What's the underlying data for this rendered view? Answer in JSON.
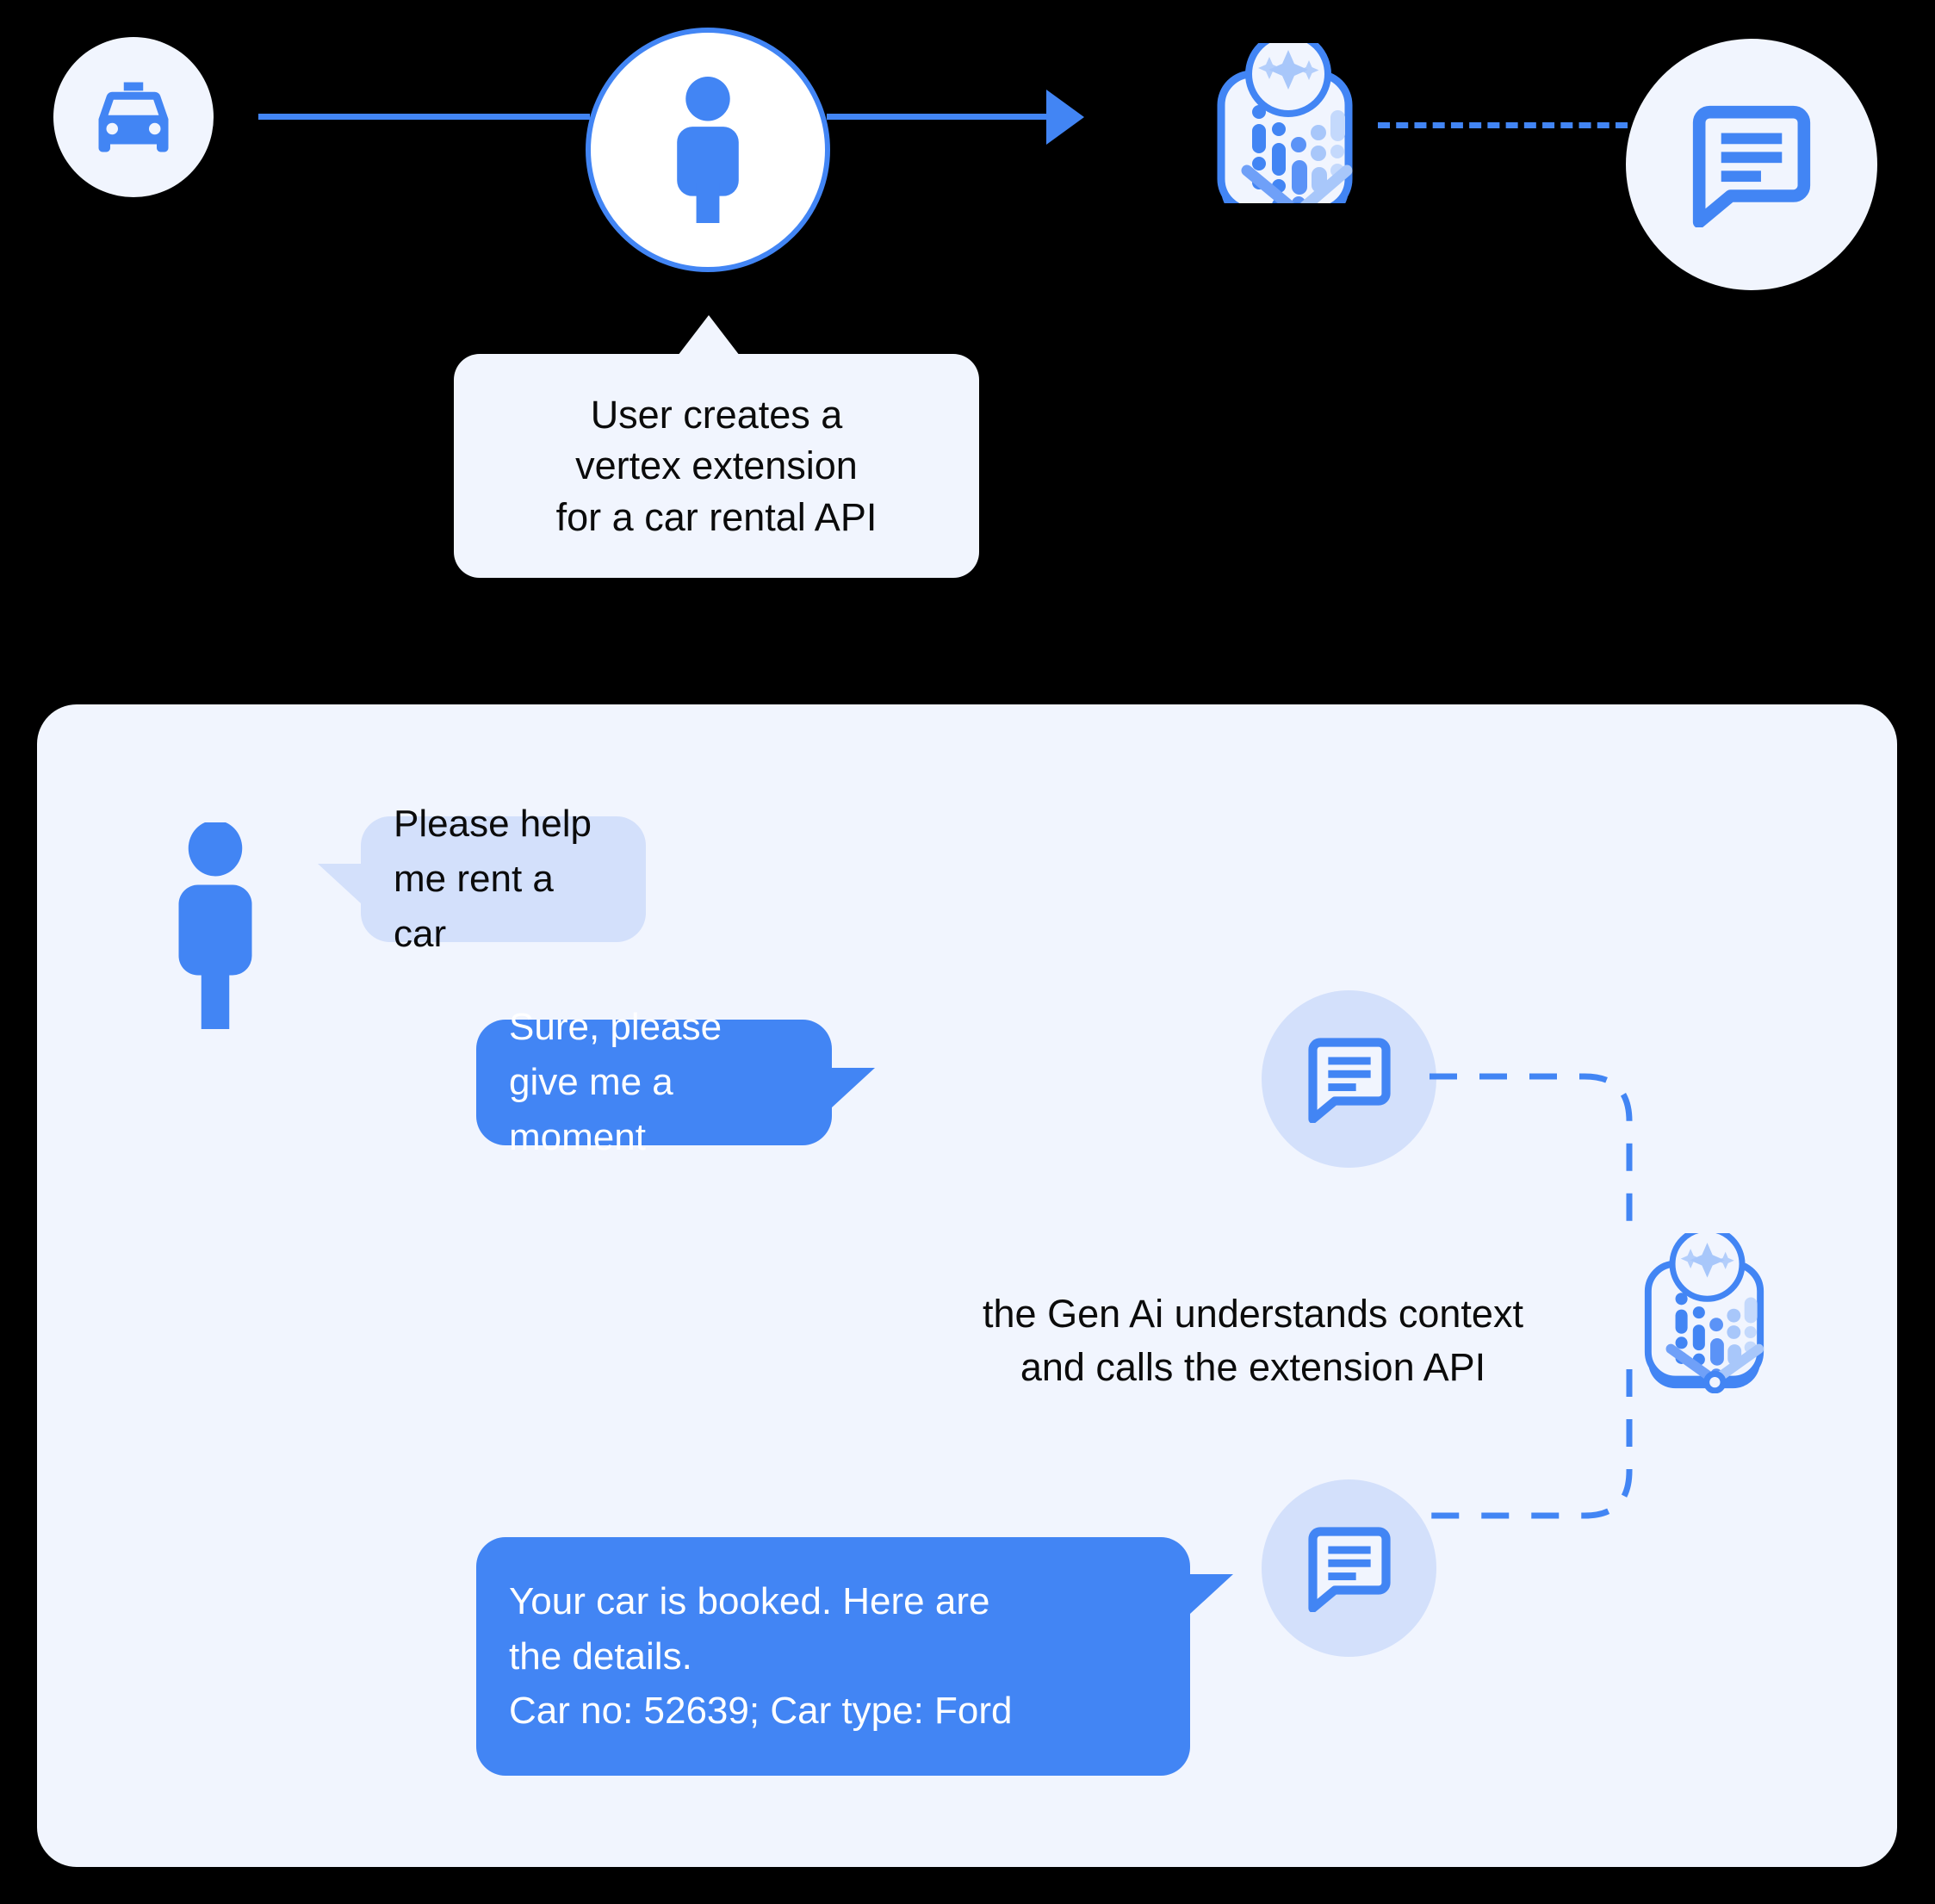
{
  "flow": {
    "nodes": [
      {
        "id": "taxi",
        "icon": "taxi-icon",
        "label": "Car rental service"
      },
      {
        "id": "user",
        "icon": "person-icon",
        "label": "User"
      },
      {
        "id": "extension",
        "icon": "vertex-extension-icon",
        "label": "Vertex extension"
      },
      {
        "id": "chat",
        "icon": "chat-bubble-icon",
        "label": "Chat"
      }
    ],
    "callout": {
      "lines": [
        "User creates a",
        "vertex extension",
        "for a car rental API"
      ]
    }
  },
  "chat": {
    "avatar_icon": "person-icon",
    "messages": [
      {
        "id": "msg-user-1",
        "sender": "user",
        "text": "Please help me rent a car",
        "icon": null
      },
      {
        "id": "msg-bot-1",
        "sender": "bot",
        "text": "Sure, please give me a moment",
        "icon": "chat-bubble-icon"
      },
      {
        "id": "msg-bot-2",
        "sender": "bot",
        "text": "Your car is booked. Here are\nthe details.\nCar no: 52639; Car type: Ford",
        "lines": [
          "Your car is booked. Here are",
          "the details.",
          "Car no: 52639; Car type: Ford"
        ],
        "icon": "chat-bubble-icon"
      }
    ],
    "annotation": {
      "lines": [
        "the Gen Ai understands context",
        "and calls the extension API"
      ]
    },
    "extension_icon": "vertex-extension-icon"
  },
  "colors": {
    "background": "#000000",
    "panel": "#f1f5fe",
    "accent": "#4285f4",
    "accent_light": "#a8c7fa",
    "bubble_user": "#d3e0fb",
    "bubble_bot": "#4285f4",
    "text_dark": "#0b0b0b",
    "text_light": "#ffffff"
  }
}
